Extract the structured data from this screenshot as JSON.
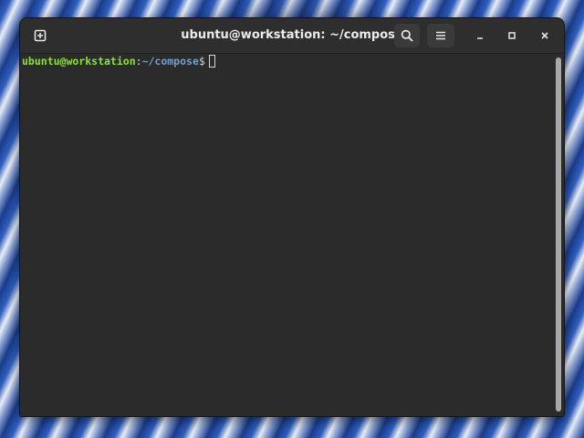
{
  "window": {
    "title": "ubuntu@workstation: ~/compose"
  },
  "headerbar": {
    "buttons": [
      {
        "name": "new-tab",
        "icon": "new-tab-icon"
      },
      {
        "name": "search",
        "icon": "search-icon"
      },
      {
        "name": "menu",
        "icon": "hamburger-menu-icon"
      },
      {
        "name": "minimize",
        "icon": "minimize-icon"
      },
      {
        "name": "maximize",
        "icon": "maximize-icon"
      },
      {
        "name": "close",
        "icon": "close-icon"
      }
    ]
  },
  "terminal": {
    "prompt_user": "ubuntu@workstation",
    "prompt_colon": ":",
    "prompt_path": "~/compose",
    "prompt_symbol": "$",
    "input": ""
  },
  "colors": {
    "user": "#8ae234",
    "path": "#729fcf",
    "background": "#2b2b2b",
    "headerbar": "#2e2e2e"
  }
}
